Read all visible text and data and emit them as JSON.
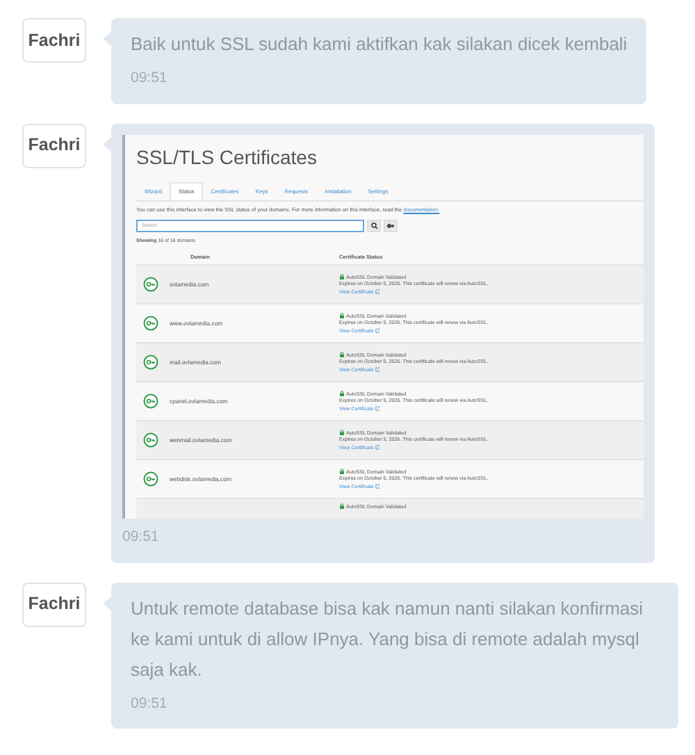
{
  "messages": [
    {
      "kind": "text",
      "sender": "Fachri",
      "text": "Baik untuk SSL sudah kami aktifkan kak silakan dicek kembali",
      "time": "09:51"
    },
    {
      "kind": "image",
      "sender": "Fachri",
      "time": "09:51",
      "screenshot": {
        "title": "SSL/TLS Certificates",
        "tabs": [
          {
            "label": "Wizard",
            "selected": false
          },
          {
            "label": "Status",
            "selected": true
          },
          {
            "label": "Certificates",
            "selected": false
          },
          {
            "label": "Keys",
            "selected": false
          },
          {
            "label": "Requests",
            "selected": false
          },
          {
            "label": "Installation",
            "selected": false
          },
          {
            "label": "Settings",
            "selected": false
          }
        ],
        "intro": "You can use this interface to view the SSL status of your domains. For more information on this interface, read the",
        "intro_link": "documentation.",
        "search": {
          "placeholder": "Search"
        },
        "showing": "**Showing** 16 of 16 domains",
        "columns": [
          "Domain",
          "Certificate Status"
        ],
        "rows": [
          {
            "domain": "ovlamedia.com",
            "status": "AutoSSL Domain Validated",
            "expires": "Expires on October 5, 2026. This certificate will renew via AutoSSL.",
            "link": "View Certificate"
          },
          {
            "domain": "www.ovlamedia.com",
            "status": "AutoSSL Domain Validated",
            "expires": "Expires on October 5, 2026. This certificate will renew via AutoSSL.",
            "link": "View Certificate"
          },
          {
            "domain": "mail.ovlamedia.com",
            "status": "AutoSSL Domain Validated",
            "expires": "Expires on October 5, 2026. This certificate will renew via AutoSSL.",
            "link": "View Certificate"
          },
          {
            "domain": "cpanel.ovlamedia.com",
            "status": "AutoSSL Domain Validated",
            "expires": "Expires on October 5, 2026. This certificate will renew via AutoSSL.",
            "link": "View Certificate"
          },
          {
            "domain": "webmail.ovlamedia.com",
            "status": "AutoSSL Domain Validated",
            "expires": "Expires on October 5, 2026. This certificate will renew via AutoSSL.",
            "link": "View Certificate"
          },
          {
            "domain": "webdisk.ovlamedia.com",
            "status": "AutoSSL Domain Validated",
            "expires": "Expires on October 5, 2026. This certificate will renew via AutoSSL.",
            "link": "View Certificate"
          },
          {
            "status": "AutoSSL Domain Validated"
          }
        ]
      }
    },
    {
      "kind": "text",
      "sender": "Fachri",
      "text": "Untuk remote database bisa kak namun nanti silakan konfirmasi ke kami untuk di allow IPnya. Yang bisa di remote adalah mysql saja kak.",
      "time": "09:51"
    }
  ]
}
